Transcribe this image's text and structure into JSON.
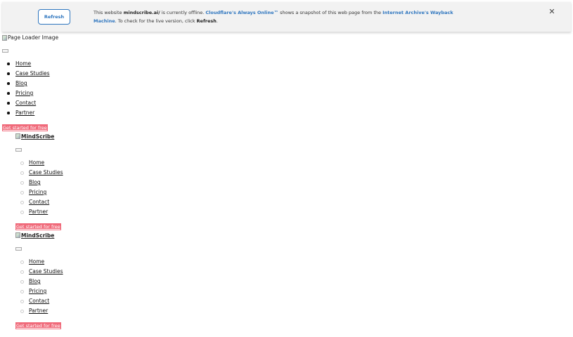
{
  "banner": {
    "refresh_label": "Refresh",
    "text_1": "This website ",
    "domain": "mindscribe.ai/",
    "text_2": " is currently offline. ",
    "always_online": "Cloudflare's Always Online™",
    "text_3": " shows a snapshot of this web page from the ",
    "wayback": "Internet Archive's Wayback Machine",
    "text_4": ". To check for the live version, click ",
    "refresh_word": "Refresh",
    "text_5": ".",
    "close_glyph": "✕"
  },
  "loader_alt": "Page Loader Image",
  "nav": {
    "items": [
      "Home",
      "Case Studies",
      "Blog",
      "Pricing",
      "Contact",
      "Partner"
    ]
  },
  "cta_label": "Get started for free",
  "logo_alt": "MindScribe",
  "colors": {
    "banner_bg": "#f2f2f2",
    "link_blue": "#2f76bf",
    "cta_bg": "#f06a7a"
  }
}
